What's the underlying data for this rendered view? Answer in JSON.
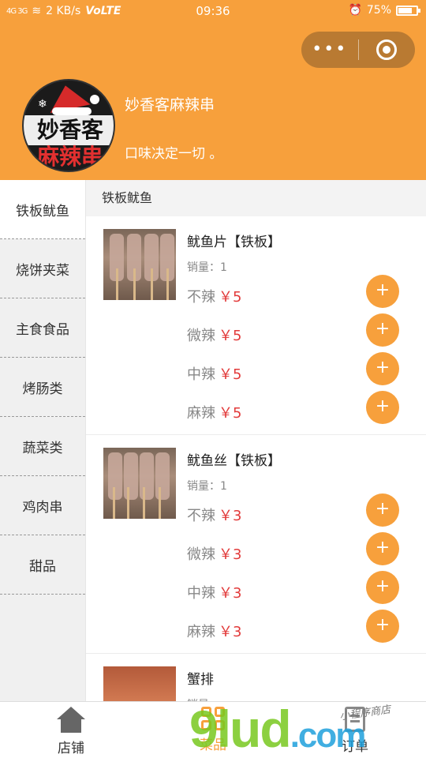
{
  "status_bar": {
    "signal": "4G 3G",
    "network_speed": "2 KB/s",
    "volte": "VoLTE",
    "time": "09:36",
    "battery": "75%"
  },
  "header": {
    "shop_name": "妙香客麻辣串",
    "slogan": "口味决定一切 。",
    "logo_text_top": "妙香客",
    "logo_text_bottom": "麻辣串",
    "capsule_more": "•••",
    "accent_color": "#f7a03c"
  },
  "sidebar": {
    "categories": [
      "铁板鱿鱼",
      "烧饼夹菜",
      "主食食品",
      "烤肠类",
      "蔬菜类",
      "鸡肉串",
      "甜品"
    ]
  },
  "content": {
    "section_title": "铁板鱿鱼",
    "items": [
      {
        "name": "鱿鱼片【铁板】",
        "sales": "销量：1",
        "options": [
          {
            "label": "不辣",
            "price": "￥5"
          },
          {
            "label": "微辣",
            "price": "￥5"
          },
          {
            "label": "中辣",
            "price": "￥5"
          },
          {
            "label": "麻辣",
            "price": "￥5"
          }
        ]
      },
      {
        "name": "鱿鱼丝【铁板】",
        "sales": "销量：1",
        "options": [
          {
            "label": "不辣",
            "price": "￥3"
          },
          {
            "label": "微辣",
            "price": "￥3"
          },
          {
            "label": "中辣",
            "price": "￥3"
          },
          {
            "label": "麻辣",
            "price": "￥3"
          }
        ]
      },
      {
        "name": "蟹排",
        "sales": "销量",
        "options": []
      }
    ],
    "add_symbol": "+"
  },
  "tabbar": {
    "tabs": [
      "店铺",
      "菜品",
      "订单"
    ]
  },
  "watermark": {
    "text": "9lud",
    "suffix": ".com",
    "sub": "小程序商店"
  }
}
